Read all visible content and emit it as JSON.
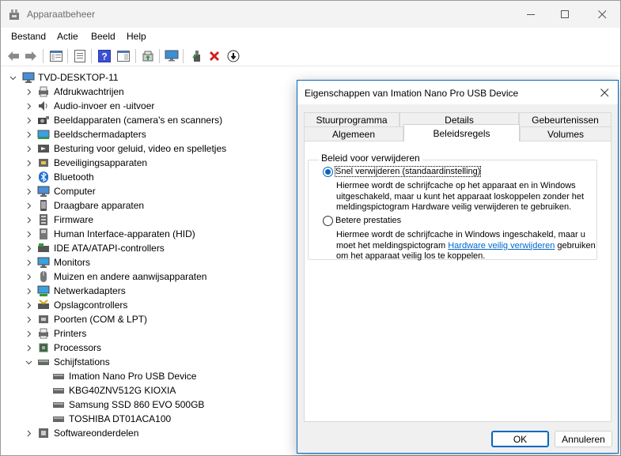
{
  "window": {
    "title": "Apparaatbeheer"
  },
  "menu": [
    "Bestand",
    "Actie",
    "Beeld",
    "Help"
  ],
  "tree": {
    "root": "TVD-DESKTOP-11",
    "categories": [
      {
        "label": "Afdrukwachtrijen",
        "icon": "printer-queue-icon"
      },
      {
        "label": "Audio-invoer en -uitvoer",
        "icon": "speaker-icon"
      },
      {
        "label": "Beeldapparaten (camera's en scanners)",
        "icon": "camera-icon"
      },
      {
        "label": "Beeldschermadapters",
        "icon": "display-adapter-icon"
      },
      {
        "label": "Besturing voor geluid, video en spelletjes",
        "icon": "sound-video-icon"
      },
      {
        "label": "Beveiligingsapparaten",
        "icon": "security-device-icon"
      },
      {
        "label": "Bluetooth",
        "icon": "bluetooth-icon"
      },
      {
        "label": "Computer",
        "icon": "computer-icon"
      },
      {
        "label": "Draagbare apparaten",
        "icon": "portable-device-icon"
      },
      {
        "label": "Firmware",
        "icon": "firmware-icon"
      },
      {
        "label": "Human Interface-apparaten (HID)",
        "icon": "hid-icon"
      },
      {
        "label": "IDE ATA/ATAPI-controllers",
        "icon": "ide-controller-icon"
      },
      {
        "label": "Monitors",
        "icon": "monitor-icon"
      },
      {
        "label": "Muizen en andere aanwijsapparaten",
        "icon": "mouse-icon"
      },
      {
        "label": "Netwerkadapters",
        "icon": "network-adapter-icon"
      },
      {
        "label": "Opslagcontrollers",
        "icon": "storage-controller-icon"
      },
      {
        "label": "Poorten (COM & LPT)",
        "icon": "port-icon"
      },
      {
        "label": "Printers",
        "icon": "printer-icon"
      },
      {
        "label": "Processors",
        "icon": "processor-icon"
      },
      {
        "label": "Schijfstations",
        "icon": "disk-drive-icon",
        "expanded": true
      },
      {
        "label": "Imation Nano Pro USB Device",
        "icon": "disk-drive-icon",
        "child": true
      },
      {
        "label": "KBG40ZNV512G KIOXIA",
        "icon": "disk-drive-icon",
        "child": true
      },
      {
        "label": "Samsung SSD 860 EVO 500GB",
        "icon": "disk-drive-icon",
        "child": true
      },
      {
        "label": "TOSHIBA DT01ACA100",
        "icon": "disk-drive-icon",
        "child": true
      },
      {
        "label": "Softwareonderdelen",
        "icon": "software-component-icon"
      }
    ]
  },
  "dialog": {
    "title": "Eigenschappen van Imation Nano Pro USB Device",
    "tabs_back": [
      "Stuurprogramma",
      "Details",
      "Gebeurtenissen"
    ],
    "tabs_front": [
      "Algemeen",
      "Beleidsregels",
      "Volumes"
    ],
    "active_tab": "Beleidsregels",
    "group_label": "Beleid voor verwijderen",
    "option1": {
      "label": "Snel verwijderen (standaardinstelling)",
      "selected": true,
      "desc_line1": "Hiermee wordt de schrijfcache op het apparaat en in Windows",
      "desc_line2": "uitgeschakeld, maar u kunt het apparaat loskoppelen zonder het",
      "desc_line3": "meldingspictogram Hardware veilig verwijderen te gebruiken."
    },
    "option2": {
      "label": "Betere prestaties",
      "selected": false,
      "desc_line1": "Hiermee wordt de schrijfcache in Windows ingeschakeld, maar u",
      "desc_line2_pre": "moet het meldingspictogram ",
      "desc_link": "Hardware veilig verwijderen",
      "desc_line2_post": " gebruiken",
      "desc_line3": "om het apparaat veilig los te koppelen."
    },
    "ok_label": "OK",
    "cancel_label": "Annuleren"
  },
  "colors": {
    "accent": "#0067c0",
    "link": "#0066cc"
  }
}
